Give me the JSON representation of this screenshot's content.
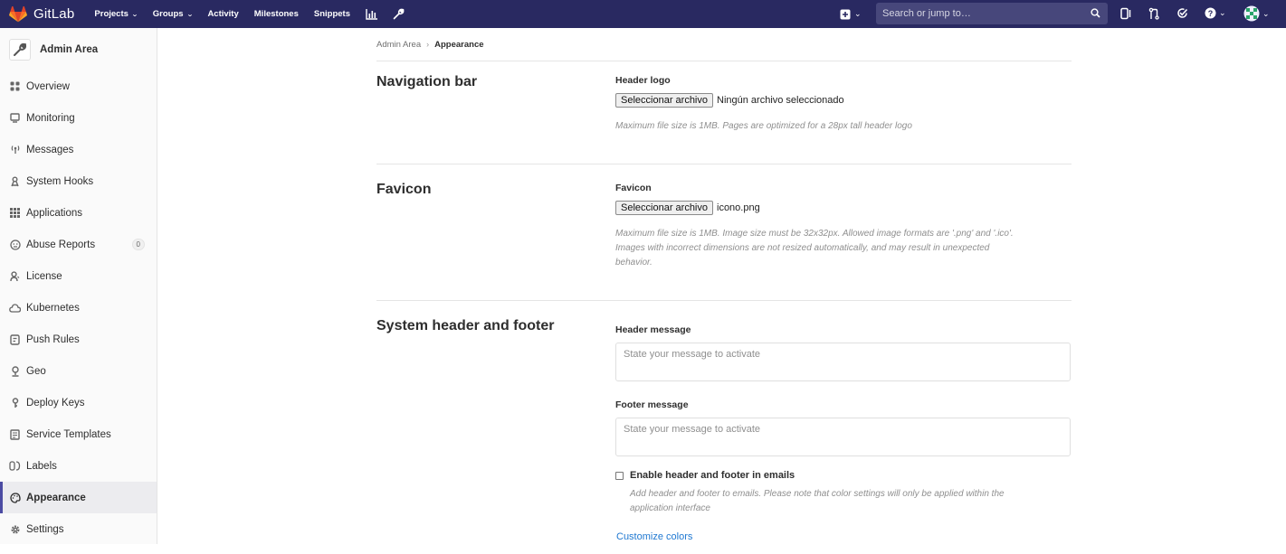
{
  "topnav": {
    "brand": "GitLab",
    "links": [
      {
        "label": "Projects",
        "dropdown": true
      },
      {
        "label": "Groups",
        "dropdown": true
      },
      {
        "label": "Activity",
        "dropdown": false
      },
      {
        "label": "Milestones",
        "dropdown": false
      },
      {
        "label": "Snippets",
        "dropdown": false
      }
    ],
    "icons": [
      "chart-icon",
      "wrench-icon"
    ],
    "search_placeholder": "Search or jump to…",
    "right_icons": [
      "plus-square-icon",
      "issues-icon",
      "merge-request-icon",
      "todo-check-icon",
      "help-icon",
      "user-avatar"
    ],
    "colors": {
      "bar": "#292961",
      "search": "#47477b",
      "accent": "#4b4ba3",
      "link": "#1f78d1"
    }
  },
  "sidebar": {
    "title": "Admin Area",
    "items": [
      {
        "label": "Overview",
        "icon": "overview-icon"
      },
      {
        "label": "Monitoring",
        "icon": "monitor-icon"
      },
      {
        "label": "Messages",
        "icon": "broadcast-icon"
      },
      {
        "label": "System Hooks",
        "icon": "hook-icon"
      },
      {
        "label": "Applications",
        "icon": "grid-icon"
      },
      {
        "label": "Abuse Reports",
        "icon": "emoji-icon",
        "badge": "0"
      },
      {
        "label": "License",
        "icon": "license-icon"
      },
      {
        "label": "Kubernetes",
        "icon": "cloud-icon"
      },
      {
        "label": "Push Rules",
        "icon": "push-rules-icon"
      },
      {
        "label": "Geo",
        "icon": "pin-icon"
      },
      {
        "label": "Deploy Keys",
        "icon": "key-icon"
      },
      {
        "label": "Service Templates",
        "icon": "template-icon"
      },
      {
        "label": "Labels",
        "icon": "labels-icon"
      },
      {
        "label": "Appearance",
        "icon": "palette-icon",
        "active": true
      },
      {
        "label": "Settings",
        "icon": "settings-icon"
      }
    ]
  },
  "breadcrumb": {
    "parent": "Admin Area",
    "current": "Appearance"
  },
  "sections": {
    "navbar": {
      "title": "Navigation bar",
      "field_label": "Header logo",
      "button": "Seleccionar archivo",
      "file": "Ningún archivo seleccionado",
      "help": "Maximum file size is 1MB. Pages are optimized for a 28px tall header logo"
    },
    "favicon": {
      "title": "Favicon",
      "field_label": "Favicon",
      "button": "Seleccionar archivo",
      "file": "icono.png",
      "help_line1": "Maximum file size is 1MB. Image size must be 32x32px. Allowed image formats are '.png' and '.ico'.",
      "help_line2": "Images with incorrect dimensions are not resized automatically, and may result in unexpected",
      "help_line3": "behavior."
    },
    "system": {
      "title": "System header and footer",
      "header_label": "Header message",
      "header_placeholder": "State your message to activate",
      "footer_label": "Footer message",
      "footer_placeholder": "State your message to activate",
      "checkbox_label": "Enable header and footer in emails",
      "checkbox_checked": false,
      "checkbox_help_line1": "Add header and footer to emails. Please note that color settings will only be applied within the",
      "checkbox_help_line2": "application interface",
      "customize_link": "Customize colors"
    }
  }
}
